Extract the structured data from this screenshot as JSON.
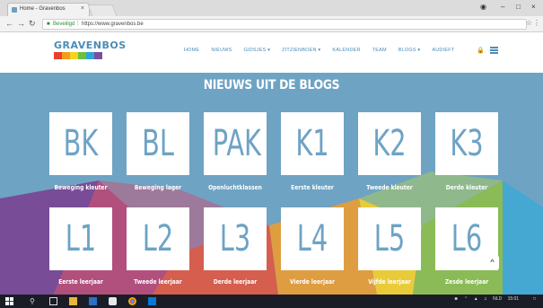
{
  "browser": {
    "tab_title": "Home - Gravenbos",
    "tab_close": "×",
    "url_secure_label": "Beveiligd",
    "url_separator": "|",
    "url": "https://www.gravenbos.be",
    "window_controls": [
      "–",
      "□",
      "×"
    ]
  },
  "site": {
    "logo_text": "GRAVENBOS",
    "logo_colors": [
      "#e8412c",
      "#f39c1f",
      "#f5d31e",
      "#6cbf3f",
      "#2fa4d8",
      "#7b4fa0"
    ],
    "nav": [
      "HOME",
      "NIEUWS",
      "GIDSJES ▾",
      "ZITZIENBOEN ▾",
      "KALENDER",
      "TEAM",
      "BLOGS ▾",
      "AUDIEFT"
    ],
    "accent": "#6ea3c4"
  },
  "main": {
    "title": "NIEUWS UIT DE BLOGS",
    "blogs": [
      {
        "code": "BK",
        "label": "Beweging kleuter"
      },
      {
        "code": "BL",
        "label": "Beweging lager"
      },
      {
        "code": "PAK",
        "label": "Openluchtklassen"
      },
      {
        "code": "K1",
        "label": "Eerste kleuter"
      },
      {
        "code": "K2",
        "label": "Tweede kleuter"
      },
      {
        "code": "K3",
        "label": "Derde kleuter"
      },
      {
        "code": "L1",
        "label": "Eerste leerjaar"
      },
      {
        "code": "L2",
        "label": "Tweede leerjaar"
      },
      {
        "code": "L3",
        "label": "Derde leerjaar"
      },
      {
        "code": "L4",
        "label": "Vierde leerjaar"
      },
      {
        "code": "L5",
        "label": "Vijfde leerjaar"
      },
      {
        "code": "L6",
        "label": "Zesde leerjaar"
      }
    ],
    "back_to_top": "^"
  },
  "taskbar": {
    "language": "NLD",
    "time": "15:01"
  }
}
